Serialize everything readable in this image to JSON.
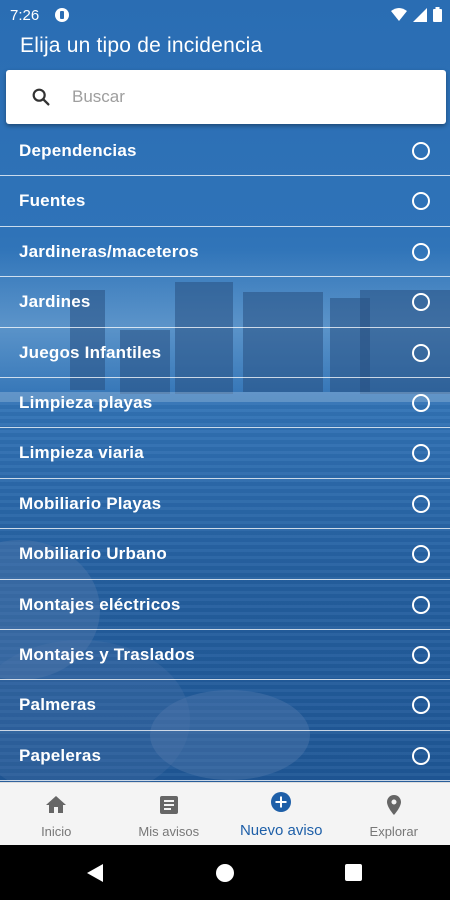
{
  "status_bar": {
    "time": "7:26"
  },
  "header": {
    "title": "Elija un tipo de incidencia"
  },
  "search": {
    "placeholder": "Buscar",
    "value": ""
  },
  "incident_types": [
    {
      "label": "Dependencias",
      "selected": false
    },
    {
      "label": "Fuentes",
      "selected": false
    },
    {
      "label": "Jardineras/maceteros",
      "selected": false
    },
    {
      "label": "Jardines",
      "selected": false
    },
    {
      "label": "Juegos Infantiles",
      "selected": false
    },
    {
      "label": "Limpieza playas",
      "selected": false
    },
    {
      "label": "Limpieza viaria",
      "selected": false
    },
    {
      "label": "Mobiliario Playas",
      "selected": false
    },
    {
      "label": "Mobiliario Urbano",
      "selected": false
    },
    {
      "label": "Montajes eléctricos",
      "selected": false
    },
    {
      "label": "Montajes y Traslados",
      "selected": false
    },
    {
      "label": "Palmeras",
      "selected": false
    },
    {
      "label": "Papeleras",
      "selected": false
    }
  ],
  "bottom_nav": [
    {
      "label": "Inicio",
      "icon": "home-icon",
      "active": false
    },
    {
      "label": "Mis avisos",
      "icon": "document-icon",
      "active": false
    },
    {
      "label": "Nuevo aviso",
      "icon": "add-circle-icon",
      "active": true
    },
    {
      "label": "Explorar",
      "icon": "location-pin-icon",
      "active": false
    }
  ],
  "colors": {
    "primary": "#1e5fa8",
    "nav_inactive": "#777777",
    "nav_background": "#f4f4f4"
  }
}
